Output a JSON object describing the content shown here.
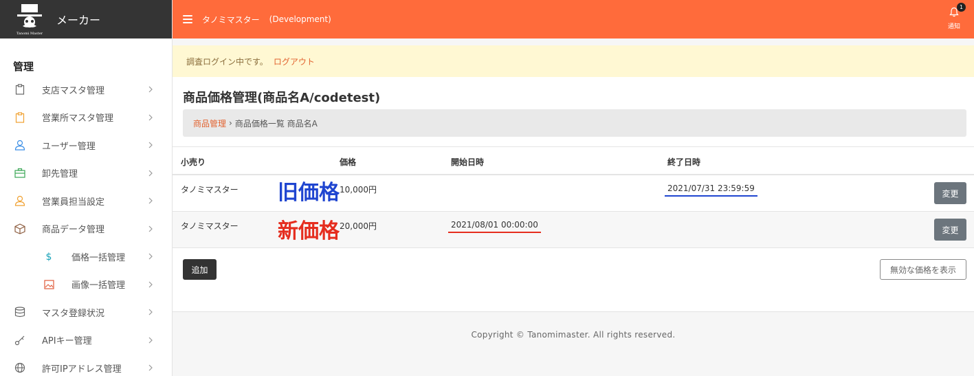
{
  "brand": {
    "name": "メーカー",
    "logo_icon": "top-hat-mustache-logo",
    "logo_text": "Tanomi Master"
  },
  "header": {
    "title": "タノミマスター",
    "env": "(Development)",
    "notification_label": "通知",
    "notification_count": "1"
  },
  "sidebar": {
    "section_title": "管理",
    "items": [
      {
        "label": "支店マスタ管理",
        "icon": "clipboard-icon",
        "color": "#666666"
      },
      {
        "label": "営業所マスタ管理",
        "icon": "clipboard-icon",
        "color": "#f0a030"
      },
      {
        "label": "ユーザー管理",
        "icon": "user-icon",
        "color": "#3a8ee6"
      },
      {
        "label": "卸先管理",
        "icon": "briefcase-icon",
        "color": "#3aa655"
      },
      {
        "label": "営業員担当設定",
        "icon": "person-icon",
        "color": "#f0a030"
      },
      {
        "label": "商品データ管理",
        "icon": "box-icon",
        "color": "#8b5a3c"
      },
      {
        "label": "価格一括管理",
        "icon": "dollar-icon",
        "color": "#17a2b8",
        "sub": true
      },
      {
        "label": "画像一括管理",
        "icon": "image-icon",
        "color": "#e05a3a",
        "sub": true
      },
      {
        "label": "マスタ登録状況",
        "icon": "database-icon",
        "color": "#666666"
      },
      {
        "label": "APIキー管理",
        "icon": "key-icon",
        "color": "#666666"
      },
      {
        "label": "許可IPアドレス管理",
        "icon": "globe-icon",
        "color": "#666666"
      }
    ]
  },
  "alert": {
    "message": "調査ログイン中です。",
    "logout_link": "ログアウト"
  },
  "page": {
    "title": "商品価格管理(商品名A/codetest)",
    "breadcrumb": {
      "link": "商品管理",
      "separator": "›",
      "current": "商品価格一覧 商品名A"
    }
  },
  "table": {
    "headers": {
      "retailer": "小売り",
      "price": "価格",
      "start": "開始日時",
      "end": "終了日時"
    },
    "rows": [
      {
        "retailer": "タノミマスター",
        "price": "10,000円",
        "start": "",
        "end": "2021/07/31 23:59:59",
        "action": "変更",
        "annotation": "旧価格"
      },
      {
        "retailer": "タノミマスター",
        "price": "20,000円",
        "start": "2021/08/01 00:00:00",
        "end": "",
        "action": "変更",
        "annotation": "新価格"
      }
    ]
  },
  "actions": {
    "add": "追加",
    "show_invalid": "無効な価格を表示"
  },
  "footer": {
    "copyright": "Copyright © Tanomimaster. All rights reserved."
  },
  "colors": {
    "header": "#ff6b3b",
    "sidebar_brand": "#343434",
    "annot_old": "#1f45d0",
    "annot_new": "#e52d1e"
  }
}
